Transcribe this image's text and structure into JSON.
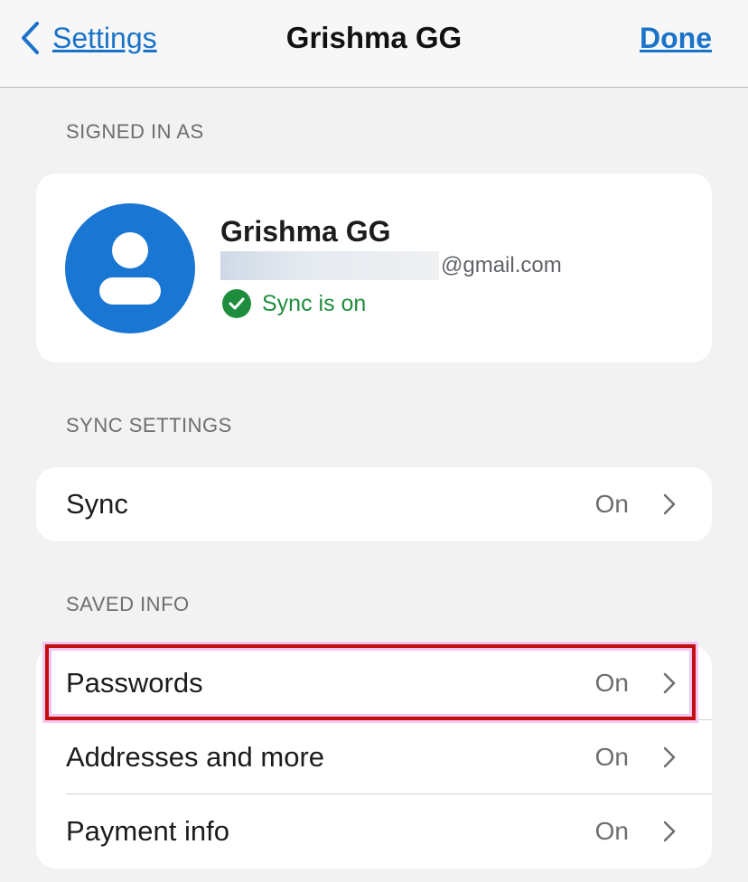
{
  "navbar": {
    "back_label": "Settings",
    "title": "Grishma GG",
    "done_label": "Done"
  },
  "signed_in": {
    "header": "SIGNED IN AS",
    "name": "Grishma GG",
    "email_suffix": "@gmail.com",
    "sync_status": "Sync is on"
  },
  "sync_settings": {
    "header": "SYNC SETTINGS",
    "items": [
      {
        "label": "Sync",
        "value": "On"
      }
    ]
  },
  "saved_info": {
    "header": "SAVED INFO",
    "items": [
      {
        "label": "Passwords",
        "value": "On"
      },
      {
        "label": "Addresses and more",
        "value": "On"
      },
      {
        "label": "Payment info",
        "value": "On"
      }
    ]
  },
  "colors": {
    "accent": "#1a73c8",
    "avatar": "#1976d2",
    "sync_green": "#1e8e3e",
    "highlight_border": "#c10e0e"
  }
}
